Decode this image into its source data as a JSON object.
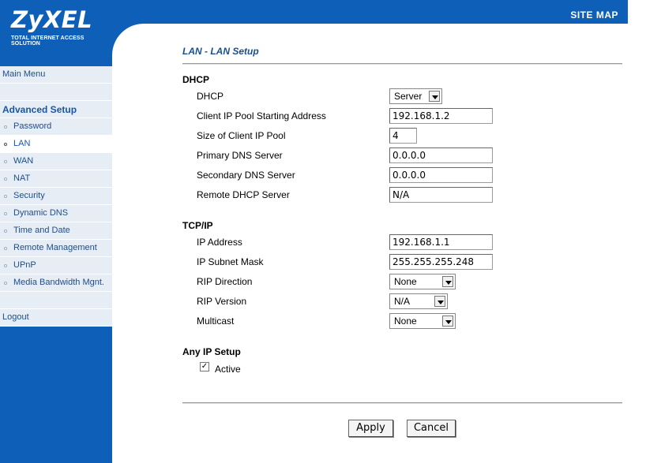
{
  "logo": {
    "title": "ZyXEL",
    "subtitle": "Total Internet Access Solution"
  },
  "topbar": {
    "site_map": "SITE MAP"
  },
  "sidebar": {
    "main_menu": "Main Menu",
    "advanced_setup": "Advanced Setup",
    "items": [
      "Password",
      "LAN",
      "WAN",
      "NAT",
      "Security",
      "Dynamic DNS",
      "Time and Date",
      "Remote Management",
      "UPnP",
      "Media Bandwidth Mgnt."
    ],
    "logout": "Logout"
  },
  "page": {
    "title": "LAN - LAN Setup",
    "dhcp_section": "DHCP",
    "dhcp": {
      "dhcp_label": "DHCP",
      "dhcp_value": "Server",
      "pool_start_label": "Client IP Pool Starting Address",
      "pool_start_value": "192.168.1.2",
      "pool_size_label": "Size of Client IP Pool",
      "pool_size_value": "4",
      "primary_dns_label": "Primary DNS Server",
      "primary_dns_value": "0.0.0.0",
      "secondary_dns_label": "Secondary DNS Server",
      "secondary_dns_value": "0.0.0.0",
      "remote_dhcp_label": "Remote DHCP Server",
      "remote_dhcp_value": "N/A"
    },
    "tcpip_section": "TCP/IP",
    "tcpip": {
      "ip_label": "IP Address",
      "ip_value": "192.168.1.1",
      "mask_label": "IP Subnet Mask",
      "mask_value": "255.255.255.248",
      "rip_dir_label": "RIP Direction",
      "rip_dir_value": "None",
      "rip_ver_label": "RIP Version",
      "rip_ver_value": "N/A",
      "multicast_label": "Multicast",
      "multicast_value": "None"
    },
    "anyip_section": "Any IP Setup",
    "anyip": {
      "active_label": "Active",
      "active_checked": true
    },
    "buttons": {
      "apply": "Apply",
      "cancel": "Cancel"
    }
  },
  "colors": {
    "brand_blue": "#0d5fb8",
    "nav_bg": "#e6edf5",
    "title_blue": "#1a4f8c"
  }
}
